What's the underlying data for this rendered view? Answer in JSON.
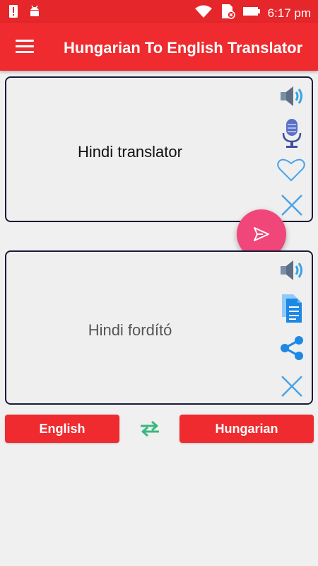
{
  "status_bar": {
    "time": "6:17 pm",
    "icons": [
      "alert-icon",
      "android-icon",
      "wifi-icon",
      "sd-card-icon",
      "battery-icon"
    ]
  },
  "app_bar": {
    "title": "Hungarian To English Translator",
    "menu_icon": "hamburger-icon"
  },
  "input_panel": {
    "text": "Hindi translator",
    "actions": [
      "speaker-icon",
      "microphone-icon",
      "heart-icon",
      "clear-icon"
    ]
  },
  "translate_fab": {
    "icon": "send-icon"
  },
  "output_panel": {
    "text": "Hindi fordító",
    "actions": [
      "speaker-icon",
      "copy-document-icon",
      "share-icon",
      "clear-icon"
    ]
  },
  "languages": {
    "source": "English",
    "target": "Hungarian",
    "swap_icon": "swap-arrows-icon"
  },
  "colors": {
    "primary": "#ef2b2f",
    "accent": "#f0467a",
    "icon_blue": "#1e88e5",
    "swap_green": "#3bb77e"
  }
}
